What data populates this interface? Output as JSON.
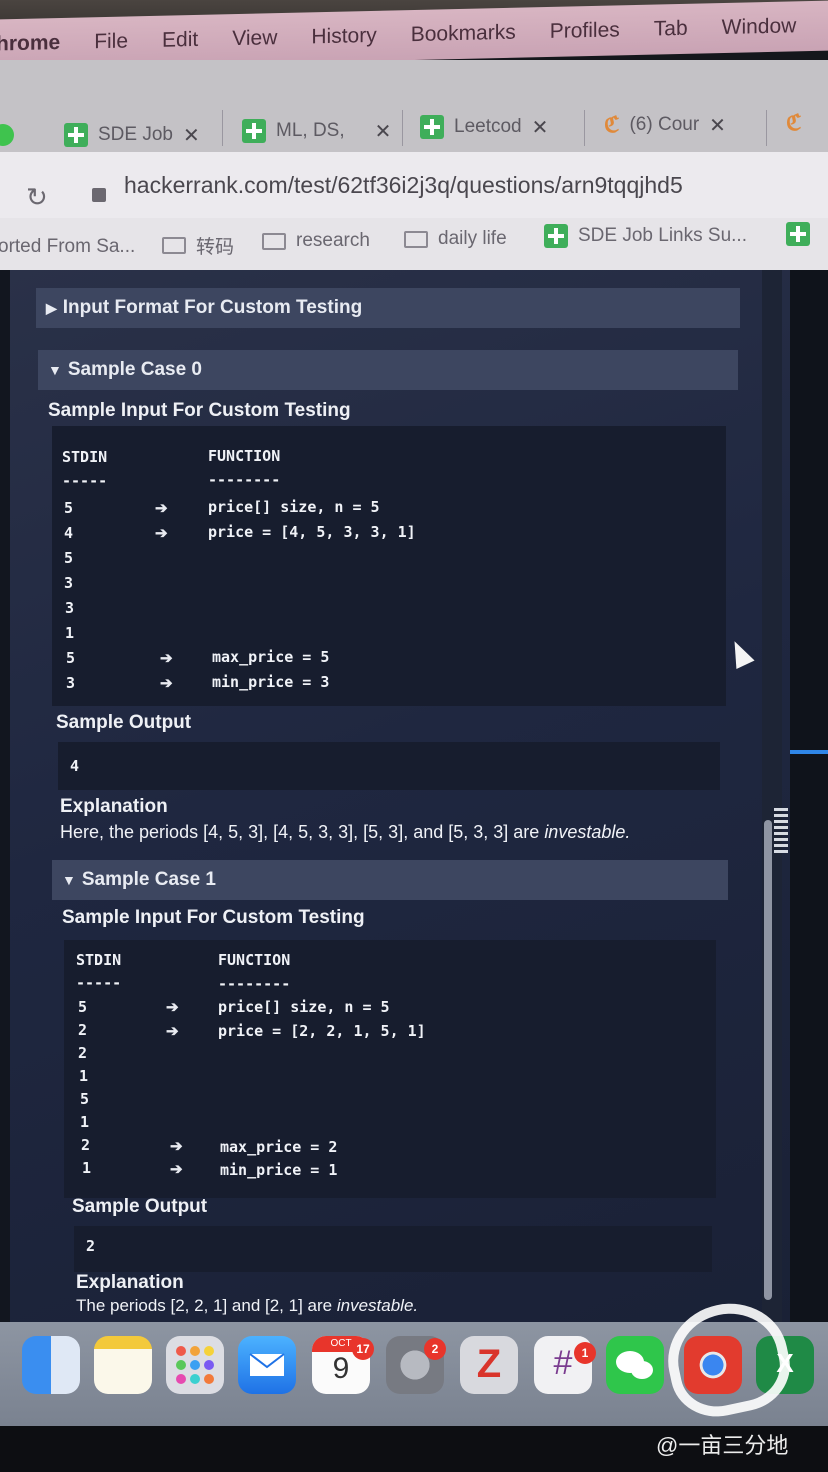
{
  "menubar": {
    "app": "hrome",
    "items": [
      "File",
      "Edit",
      "View",
      "History",
      "Bookmarks",
      "Profiles",
      "Tab",
      "Window"
    ]
  },
  "tabs": [
    {
      "label": "SDE Job",
      "icon": "green-plus-icon"
    },
    {
      "label": "ML, DS,",
      "icon": "green-plus-icon"
    },
    {
      "label": "Leetcod",
      "icon": "green-plus-icon"
    },
    {
      "label": "(6) Cour",
      "icon": "coursera-icon"
    }
  ],
  "address": {
    "url": "hackerrank.com/test/62tf36i2j3q/questions/arn9tqqjhd5"
  },
  "bookmarks": [
    {
      "label": "orted From Sa..."
    },
    {
      "label": "转码"
    },
    {
      "label": "research"
    },
    {
      "label": "daily life"
    },
    {
      "label": "SDE Job Links Su..."
    }
  ],
  "content": {
    "input_format_header": "Input Format For Custom Testing",
    "case0": {
      "header": "Sample Case 0",
      "input_title": "Sample Input For Custom Testing",
      "col_stdin": "STDIN",
      "col_function": "FUNCTION",
      "dash_stdin": "-----",
      "dash_function": "--------",
      "stdin": [
        "5",
        "4",
        "5",
        "3",
        "3",
        "1",
        "5",
        "3"
      ],
      "func": [
        "price[] size, n = 5",
        "price = [4, 5, 3, 3, 1]",
        "max_price = 5",
        "min_price = 3"
      ],
      "output_title": "Sample Output",
      "output": "4",
      "expl_title": "Explanation",
      "expl_text": "Here, the periods [4, 5, 3], [4, 5, 3, 3], [5, 3], and [5, 3, 3] are",
      "expl_em": "investable."
    },
    "case1": {
      "header": "Sample Case 1",
      "input_title": "Sample Input For Custom Testing",
      "col_stdin": "STDIN",
      "col_function": "FUNCTION",
      "dash_stdin": "-----",
      "dash_function": "--------",
      "stdin": [
        "5",
        "2",
        "2",
        "1",
        "5",
        "1",
        "2",
        "1"
      ],
      "func": [
        "price[] size, n = 5",
        "price = [2, 2, 1, 5, 1]",
        "max_price = 2",
        "min_price = 1"
      ],
      "output_title": "Sample Output",
      "output": "2",
      "expl_title": "Explanation",
      "expl_text": "The periods [2, 2, 1] and [2, 1] are",
      "expl_em": "investable."
    }
  },
  "dock": {
    "calendar_month": "OCT",
    "calendar_day": "9",
    "calendar_badge": "17",
    "settings_badge": "2",
    "slack_badge": "1"
  },
  "watermark": "@一亩三分地"
}
